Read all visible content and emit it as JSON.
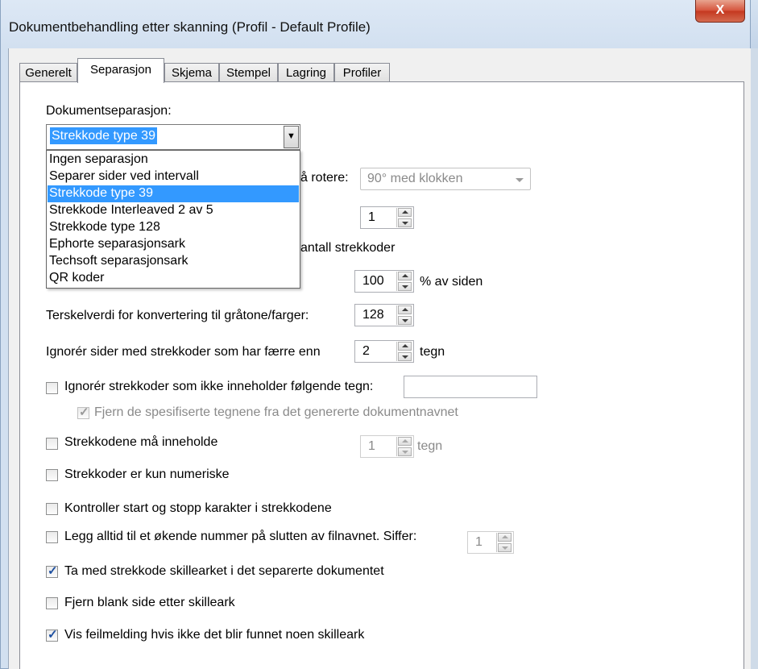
{
  "window": {
    "title": "Dokumentbehandling etter skanning (Profil - Default Profile)",
    "close_label": "X"
  },
  "tabs": [
    {
      "label": "Generelt"
    },
    {
      "label": "Separasjon"
    },
    {
      "label": "Skjema"
    },
    {
      "label": "Stempel"
    },
    {
      "label": "Lagring"
    },
    {
      "label": "Profiler"
    }
  ],
  "separation": {
    "label": "Dokumentseparasjon:",
    "selected": "Strekkode type 39",
    "options": [
      "Ingen separasjon",
      "Separer sider ved intervall",
      "Strekkode type 39",
      "Strekkode Interleaved 2 av 5",
      "Strekkode type 128",
      "Ephorte separasjonsark",
      "Techsoft separasjonsark",
      "QR koder"
    ]
  },
  "rotate": {
    "label_partial": "å rotere:",
    "value": "90° med klokken"
  },
  "count_spin": {
    "value": "1"
  },
  "barcodes_count_partial": "antall strekkoder",
  "percent": {
    "value": "100",
    "suffix": "% av siden"
  },
  "threshold": {
    "label": "Terskelverdi for konvertering til gråtone/farger:",
    "value": "128"
  },
  "ignore_fewer": {
    "label": "Ignorér sider med strekkoder som har færre enn",
    "value": "2",
    "suffix": "tegn"
  },
  "ignore_chars": {
    "label": "Ignorér strekkoder som ikke inneholder følgende tegn:",
    "value": ""
  },
  "remove_chars": {
    "label": "Fjern de spesifiserte tegnene fra det genererte dokumentnavnet"
  },
  "must_contain": {
    "label": "Strekkodene må inneholde",
    "value": "1",
    "suffix": "tegn"
  },
  "numeric_only": {
    "label": "Strekkoder er kun numeriske"
  },
  "start_stop": {
    "label": "Kontroller start og stopp karakter i strekkodene"
  },
  "append_number": {
    "label": "Legg alltid til et økende nummer på slutten av filnavnet. Siffer:",
    "value": "1"
  },
  "include_separator": {
    "label": "Ta med strekkode skillearket i det separerte dokumentet"
  },
  "remove_blank": {
    "label": "Fjern blank side etter skilleark"
  },
  "show_error": {
    "label": "Vis feilmelding hvis ikke det blir funnet noen skilleark"
  }
}
